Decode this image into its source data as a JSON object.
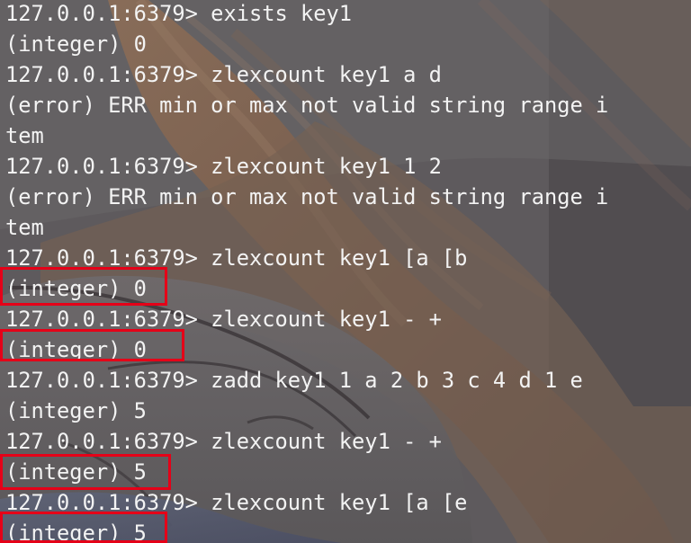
{
  "terminal": {
    "lines": [
      "127.0.0.1:6379> exists key1",
      "(integer) 0",
      "127.0.0.1:6379> zlexcount key1 a d",
      "(error) ERR min or max not valid string range i",
      "tem",
      "127.0.0.1:6379> zlexcount key1 1 2",
      "(error) ERR min or max not valid string range i",
      "tem",
      "127.0.0.1:6379> zlexcount key1 [a [b",
      "(integer) 0",
      "127.0.0.1:6379> zlexcount key1 - +",
      "(integer) 0",
      "127.0.0.1:6379> zadd key1 1 a 2 b 3 c 4 d 1 e",
      "(integer) 5",
      "127.0.0.1:6379> zlexcount key1 - +",
      "(integer) 5",
      "127.0.0.1:6379> zlexcount key1 [a [e",
      "(integer) 5"
    ]
  },
  "colors": {
    "text": "#f3f3f3",
    "highlight": "#e50018",
    "background": "#5f5b5f"
  },
  "icons": [
    "anime-background-art"
  ]
}
